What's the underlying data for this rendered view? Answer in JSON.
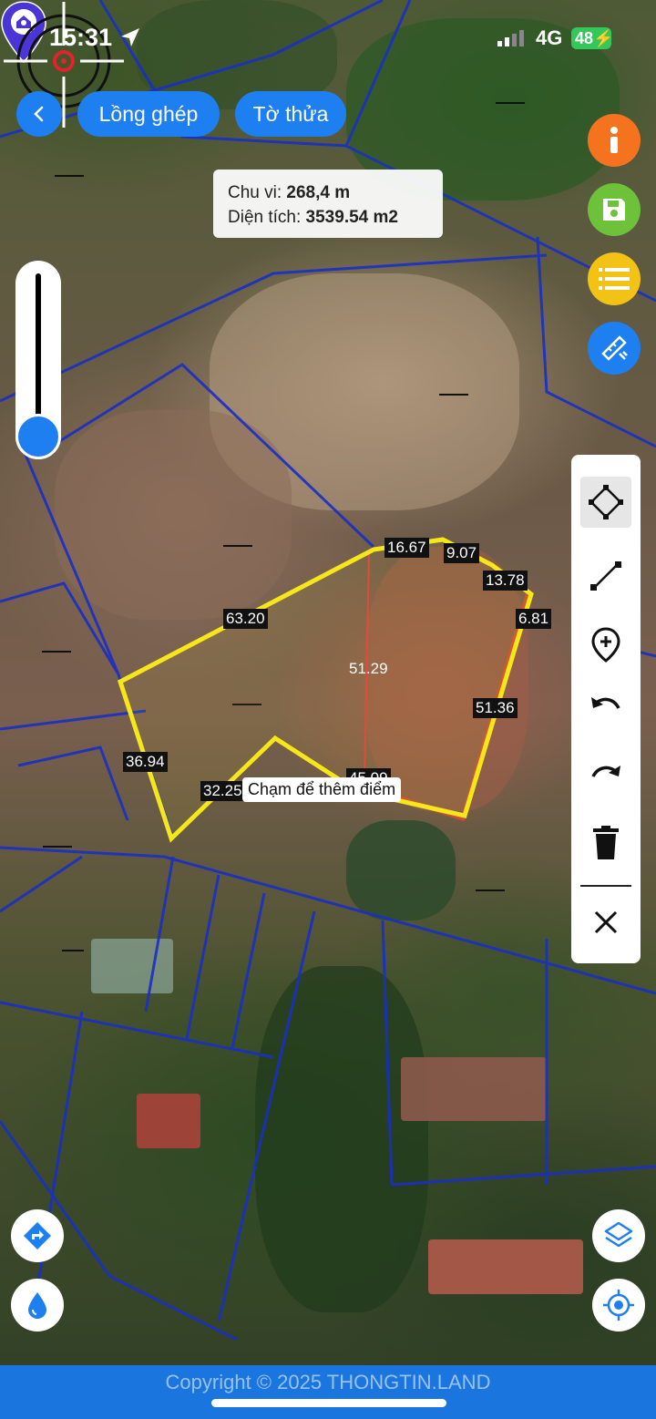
{
  "status_bar": {
    "time": "15:31",
    "network": "4G",
    "battery": "48"
  },
  "top": {
    "mode_label": "Lồng ghép",
    "plot_label": "Tờ thửa"
  },
  "info": {
    "perimeter_label": "Chu vi:",
    "perimeter_value": "268,4 m",
    "area_label": "Diện tích:",
    "area_value": "3539.54 m2"
  },
  "map": {
    "dimensions": [
      "16.67",
      "9.07",
      "13.78",
      "6.81",
      "63.20",
      "51.29",
      "51.36",
      "36.94",
      "32.25",
      "45.09"
    ],
    "hint": "Chạm để thêm điểm",
    "parcel_color": "#f5e71a",
    "boundary_color": "#1a2fc4"
  },
  "side_buttons": [
    {
      "icon": "info-icon",
      "color": "#f5731f"
    },
    {
      "icon": "save-icon",
      "color": "#6dc23a"
    },
    {
      "icon": "list-icon",
      "color": "#f2c315"
    },
    {
      "icon": "edit-ruler-icon",
      "color": "#1e7ff0"
    }
  ],
  "tools": [
    "polygon-tool-icon",
    "line-tool-icon",
    "add-point-icon",
    "undo-icon",
    "redo-icon",
    "trash-icon",
    "close-icon"
  ],
  "footer": {
    "copyright": "Copyright © 2025 THONGTIN.LAND"
  }
}
